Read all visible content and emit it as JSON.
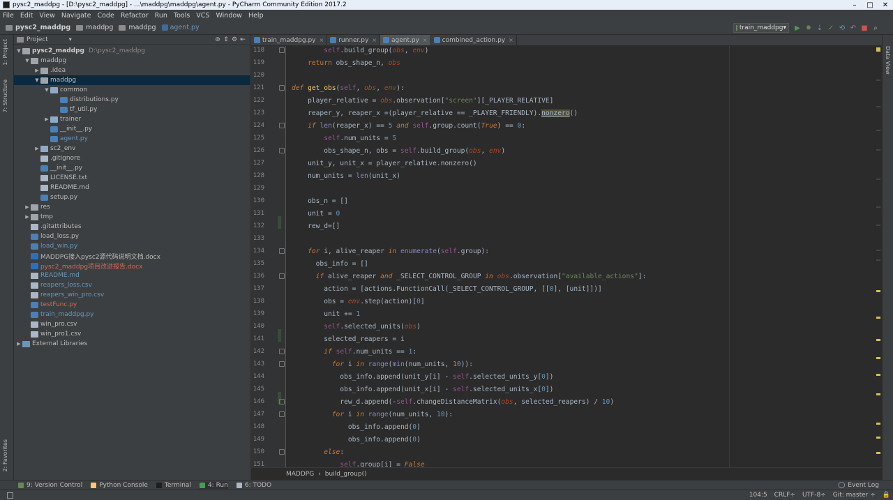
{
  "window": {
    "title": "pysc2_maddpg - [D:\\pysc2_maddpg] - ...\\maddpg\\maddpg\\agent.py - PyCharm Community Edition 2017.2",
    "controls": [
      "–",
      "□",
      "✕"
    ]
  },
  "menu": [
    "File",
    "Edit",
    "View",
    "Navigate",
    "Code",
    "Refactor",
    "Run",
    "Tools",
    "VCS",
    "Window",
    "Help"
  ],
  "breadcrumbs": [
    "pysc2_maddpg",
    "maddpg",
    "maddpg",
    "agent.py"
  ],
  "run_config": "train_maddpg",
  "left_tool_tabs": [
    "1: Project",
    "7: Structure",
    "2: Favorites"
  ],
  "right_tool_tabs": [
    "Data View"
  ],
  "project_panel": {
    "title": "Project",
    "root_name": "pysc2_maddpg",
    "root_path": "D:\\pysc2_maddpg",
    "items": [
      {
        "label": "maddpg",
        "type": "folder",
        "arrow": "▼"
      },
      {
        "label": ".idea",
        "type": "folder",
        "arrow": "▶"
      },
      {
        "label": "maddpg",
        "type": "folder",
        "arrow": "▼"
      },
      {
        "label": "common",
        "type": "pkg",
        "arrow": "▼"
      },
      {
        "label": "distributions.py",
        "type": "py",
        "arrow": ""
      },
      {
        "label": "tf_util.py",
        "type": "py",
        "arrow": ""
      },
      {
        "label": "trainer",
        "type": "pkg",
        "arrow": "▶"
      },
      {
        "label": "__init__.py",
        "type": "py",
        "arrow": ""
      },
      {
        "label": "agent.py",
        "type": "py",
        "arrow": ""
      },
      {
        "label": "sc2_env",
        "type": "pkg",
        "arrow": "▶"
      },
      {
        "label": ".gitignore",
        "type": "file",
        "arrow": ""
      },
      {
        "label": "__init__.py",
        "type": "py",
        "arrow": ""
      },
      {
        "label": "LICENSE.txt",
        "type": "file",
        "arrow": ""
      },
      {
        "label": "README.md",
        "type": "file",
        "arrow": ""
      },
      {
        "label": "setup.py",
        "type": "py",
        "arrow": ""
      },
      {
        "label": "res",
        "type": "folder",
        "arrow": "▶"
      },
      {
        "label": "tmp",
        "type": "folder",
        "arrow": "▶"
      },
      {
        "label": ".gitattributes",
        "type": "file",
        "arrow": ""
      },
      {
        "label": "load_loss.py",
        "type": "py",
        "arrow": ""
      },
      {
        "label": "load_win.py",
        "type": "py",
        "arrow": ""
      },
      {
        "label": "MADDPG接入pysc2源代码说明文档.docx",
        "type": "doc",
        "arrow": ""
      },
      {
        "label": "pysc2_maddpg项目改进报告.docx",
        "type": "doc",
        "arrow": ""
      },
      {
        "label": "README.md",
        "type": "file",
        "arrow": ""
      },
      {
        "label": "reapers_loss.csv",
        "type": "file",
        "arrow": ""
      },
      {
        "label": "reapers_win_pro.csv",
        "type": "file",
        "arrow": ""
      },
      {
        "label": "testFunc.py",
        "type": "py",
        "arrow": ""
      },
      {
        "label": "train_maddpg.py",
        "type": "py",
        "arrow": ""
      },
      {
        "label": "win_pro.csv",
        "type": "file",
        "arrow": ""
      },
      {
        "label": "win_pro1.csv",
        "type": "file",
        "arrow": ""
      },
      {
        "label": "External Libraries",
        "type": "lib",
        "arrow": "▶"
      }
    ],
    "colors": {
      "normal": "#bbbbbb",
      "modified": "#6897bb",
      "untracked": "#d1675a",
      "selected_bg": "#0d293e"
    }
  },
  "editor_tabs": [
    {
      "label": "train_maddpg.py",
      "close": "×"
    },
    {
      "label": "runner.py",
      "close": "×"
    },
    {
      "label": "agent.py",
      "close": "×",
      "active": true
    },
    {
      "label": "combined_action.py",
      "close": "×"
    }
  ],
  "code_lines": [
    {
      "n": "118",
      "html": "        <span class='self'>self</span>.build_group(<span class='par'>obs</span>, <span class='par'>env</span>)"
    },
    {
      "n": "119",
      "html": "    <span class='kwn'>return</span> obs_shape_n, <span class='par'>obs</span>"
    },
    {
      "n": "120",
      "html": ""
    },
    {
      "n": "121",
      "html": "<span class='kw'>def</span> <span class='fn'>get_obs</span>(<span class='self'>self</span>, <span class='par'>obs</span>, <span class='par'>env</span>):"
    },
    {
      "n": "122",
      "html": "    player_relative = <span class='par'>obs</span>.observation[<span class='str'>\"screen\"</span>][_PLAYER_RELATIVE]"
    },
    {
      "n": "123",
      "html": "    reaper_y, reaper_x =(player_relative == _PLAYER_FRIENDLY).<span class='warn'>nonzero</span>()"
    },
    {
      "n": "124",
      "html": "    <span class='kw'>if</span> <span class='bi'>len</span>(reaper_x) == <span class='num'>5</span> <span class='kw'>and</span> <span class='self'>self</span>.group.count(<span class='kw'>True</span>) == <span class='num'>0</span>:"
    },
    {
      "n": "125",
      "html": "        <span class='self'>self</span>.num_units = <span class='num'>5</span>"
    },
    {
      "n": "126",
      "html": "        obs_shape_n, obs = <span class='self'>self</span>.build_group(<span class='par'>obs</span>, <span class='par'>env</span>)"
    },
    {
      "n": "127",
      "html": "    unit_y, unit_x = player_relative.nonzero()"
    },
    {
      "n": "128",
      "html": "    num_units = <span class='bi'>len</span>(unit_x)"
    },
    {
      "n": "129",
      "html": ""
    },
    {
      "n": "130",
      "html": "    obs_n = []"
    },
    {
      "n": "131",
      "html": "    unit = <span class='num'>0</span>"
    },
    {
      "n": "132",
      "html": "    rew_d=[]"
    },
    {
      "n": "133",
      "html": ""
    },
    {
      "n": "134",
      "html": "    <span class='kw'>for</span> i, alive_reaper <span class='kw'>in</span> <span class='bi'>enumerate</span>(<span class='self'>self</span>.group):"
    },
    {
      "n": "135",
      "html": "      obs_info = []"
    },
    {
      "n": "136",
      "html": "      <span class='kw'>if</span> alive_reaper <span class='kw'>and</span> _SELECT_CONTROL_GROUP <span class='kw'>in</span> <span class='par'>obs</span>.observation[<span class='str'>\"available_actions\"</span>]:"
    },
    {
      "n": "137",
      "html": "        action = [actions.FunctionCall(_SELECT_CONTROL_GROUP, [[<span class='num'>0</span>], [unit]])]"
    },
    {
      "n": "138",
      "html": "        obs = <span class='par'>env</span>.step(action)[<span class='num'>0</span>]"
    },
    {
      "n": "139",
      "html": "        unit += <span class='num'>1</span>"
    },
    {
      "n": "140",
      "html": "        <span class='self'>self</span>.selected_units(<span class='par'>obs</span>)"
    },
    {
      "n": "141",
      "html": "        selected_reapers = i"
    },
    {
      "n": "142",
      "html": "        <span class='kw'>if</span> <span class='self'>self</span>.num_units == <span class='num'>1</span>:"
    },
    {
      "n": "143",
      "html": "          <span class='kw'>for</span> i <span class='kw'>in</span> <span class='bi'>range</span>(<span class='bi'>min</span>(num_units, <span class='num'>10</span>)):"
    },
    {
      "n": "144",
      "html": "            obs_info.append(unit_y[i] - <span class='self'>self</span>.selected_units_y[<span class='num'>0</span>])"
    },
    {
      "n": "145",
      "html": "            obs_info.append(unit_x[i] - <span class='self'>self</span>.selected_units_x[<span class='num'>0</span>])"
    },
    {
      "n": "146",
      "html": "            rew_d.append(-<span class='self'>self</span>.changeDistanceMatrix(<span class='par'>obs</span>, selected_reapers) / <span class='num'>10</span>)"
    },
    {
      "n": "147",
      "html": "          <span class='kw'>for</span> i <span class='kw'>in</span> <span class='bi'>range</span>(num_units, <span class='num'>10</span>):"
    },
    {
      "n": "148",
      "html": "              obs_info.append(<span class='num'>0</span>)"
    },
    {
      "n": "149",
      "html": "              obs_info.append(<span class='num'>0</span>)"
    },
    {
      "n": "150",
      "html": "        <span class='kw'>else</span>:"
    },
    {
      "n": "151",
      "html": "            <span class='self'>self</span>.group[i] = <span class='kw'>False</span>"
    }
  ],
  "editor_breadcrumb": [
    "MADDPG",
    "build_group()"
  ],
  "bottom_tools": [
    {
      "label": "9: Version Control",
      "color": "#6a8759"
    },
    {
      "label": "Python Console",
      "color": "#ffc66d"
    },
    {
      "label": "Terminal",
      "color": "#1e1e1e"
    },
    {
      "label": "4: Run",
      "color": "#499c54",
      "active": true
    },
    {
      "label": "6: TODO",
      "color": "#a9b7c6"
    }
  ],
  "event_log": "Event Log",
  "status": {
    "position": "104:5",
    "line_sep": "CRLF÷",
    "encoding": "UTF-8÷",
    "git": "Git: master ÷"
  }
}
